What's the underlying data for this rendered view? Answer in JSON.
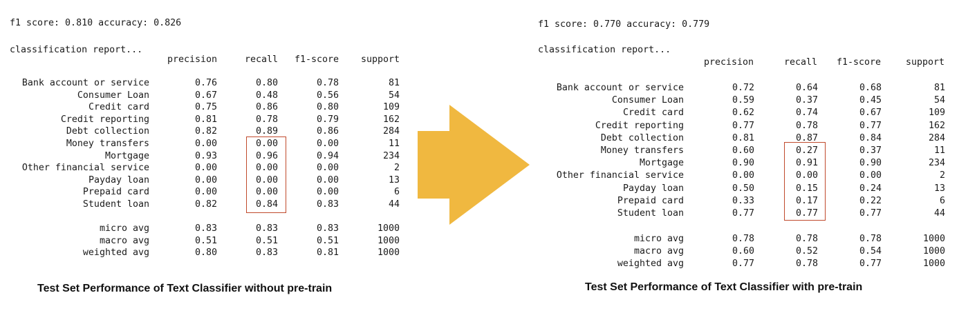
{
  "left_panel": {
    "summary": "f1 score: 0.810 accuracy: 0.826",
    "report_title": "classification report...",
    "columns": [
      "precision",
      "recall",
      "f1-score",
      "support"
    ],
    "rows": [
      {
        "label": "Bank account or service",
        "precision": "0.76",
        "recall": "0.80",
        "f1": "0.78",
        "support": "81"
      },
      {
        "label": "Consumer Loan",
        "precision": "0.67",
        "recall": "0.48",
        "f1": "0.56",
        "support": "54"
      },
      {
        "label": "Credit card",
        "precision": "0.75",
        "recall": "0.86",
        "f1": "0.80",
        "support": "109"
      },
      {
        "label": "Credit reporting",
        "precision": "0.81",
        "recall": "0.78",
        "f1": "0.79",
        "support": "162"
      },
      {
        "label": "Debt collection",
        "precision": "0.82",
        "recall": "0.89",
        "f1": "0.86",
        "support": "284"
      },
      {
        "label": "Money transfers",
        "precision": "0.00",
        "recall": "0.00",
        "f1": "0.00",
        "support": "11"
      },
      {
        "label": "Mortgage",
        "precision": "0.93",
        "recall": "0.96",
        "f1": "0.94",
        "support": "234"
      },
      {
        "label": "Other financial service",
        "precision": "0.00",
        "recall": "0.00",
        "f1": "0.00",
        "support": "2"
      },
      {
        "label": "Payday loan",
        "precision": "0.00",
        "recall": "0.00",
        "f1": "0.00",
        "support": "13"
      },
      {
        "label": "Prepaid card",
        "precision": "0.00",
        "recall": "0.00",
        "f1": "0.00",
        "support": "6"
      },
      {
        "label": "Student loan",
        "precision": "0.82",
        "recall": "0.84",
        "f1": "0.83",
        "support": "44"
      }
    ],
    "avg_rows": [
      {
        "label": "micro avg",
        "precision": "0.83",
        "recall": "0.83",
        "f1": "0.83",
        "support": "1000"
      },
      {
        "label": "macro avg",
        "precision": "0.51",
        "recall": "0.51",
        "f1": "0.51",
        "support": "1000"
      },
      {
        "label": "weighted avg",
        "precision": "0.80",
        "recall": "0.83",
        "f1": "0.81",
        "support": "1000"
      }
    ],
    "caption": "Test Set Performance of Text Classifier without pre-train"
  },
  "right_panel": {
    "summary": "f1 score: 0.770 accuracy: 0.779",
    "report_title": "classification report...",
    "columns": [
      "precision",
      "recall",
      "f1-score",
      "support"
    ],
    "rows": [
      {
        "label": "Bank account or service",
        "precision": "0.72",
        "recall": "0.64",
        "f1": "0.68",
        "support": "81"
      },
      {
        "label": "Consumer Loan",
        "precision": "0.59",
        "recall": "0.37",
        "f1": "0.45",
        "support": "54"
      },
      {
        "label": "Credit card",
        "precision": "0.62",
        "recall": "0.74",
        "f1": "0.67",
        "support": "109"
      },
      {
        "label": "Credit reporting",
        "precision": "0.77",
        "recall": "0.78",
        "f1": "0.77",
        "support": "162"
      },
      {
        "label": "Debt collection",
        "precision": "0.81",
        "recall": "0.87",
        "f1": "0.84",
        "support": "284"
      },
      {
        "label": "Money transfers",
        "precision": "0.60",
        "recall": "0.27",
        "f1": "0.37",
        "support": "11"
      },
      {
        "label": "Mortgage",
        "precision": "0.90",
        "recall": "0.91",
        "f1": "0.90",
        "support": "234"
      },
      {
        "label": "Other financial service",
        "precision": "0.00",
        "recall": "0.00",
        "f1": "0.00",
        "support": "2"
      },
      {
        "label": "Payday loan",
        "precision": "0.50",
        "recall": "0.15",
        "f1": "0.24",
        "support": "13"
      },
      {
        "label": "Prepaid card",
        "precision": "0.33",
        "recall": "0.17",
        "f1": "0.22",
        "support": "6"
      },
      {
        "label": "Student loan",
        "precision": "0.77",
        "recall": "0.77",
        "f1": "0.77",
        "support": "44"
      }
    ],
    "avg_rows": [
      {
        "label": "micro avg",
        "precision": "0.78",
        "recall": "0.78",
        "f1": "0.78",
        "support": "1000"
      },
      {
        "label": "macro avg",
        "precision": "0.60",
        "recall": "0.52",
        "f1": "0.54",
        "support": "1000"
      },
      {
        "label": "weighted avg",
        "precision": "0.77",
        "recall": "0.78",
        "f1": "0.77",
        "support": "1000"
      }
    ],
    "caption": "Test Set Performance of Text Classifier with pre-train"
  },
  "colors": {
    "highlight_box": "#c0492b",
    "arrow": "#f0b840"
  },
  "icons": {
    "transition": "right-arrow-icon"
  }
}
